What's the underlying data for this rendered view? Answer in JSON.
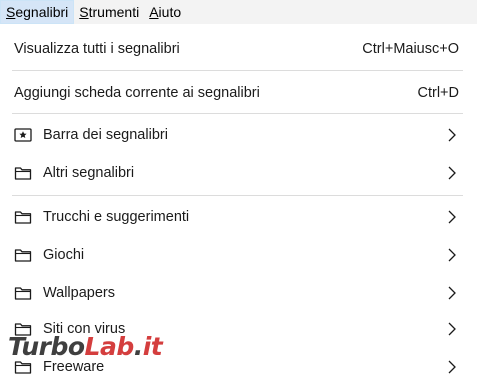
{
  "menubar": {
    "items": [
      {
        "acc": "S",
        "rest": "egnalibri",
        "active": true
      },
      {
        "acc": "S",
        "rest": "trumenti",
        "active": false
      },
      {
        "acc": "A",
        "rest": "iuto",
        "active": false
      }
    ]
  },
  "menu": {
    "show_all": {
      "label": "Visualizza tutti i segnalibri",
      "shortcut": "Ctrl+Maiusc+O"
    },
    "add_tabs": {
      "label": "Aggiungi scheda corrente ai segnalibri",
      "shortcut": "Ctrl+D"
    },
    "folders": [
      {
        "label": "Barra dei segnalibri",
        "icon": "bookmarks-toolbar-icon"
      },
      {
        "label": "Altri segnalibri",
        "icon": "folder-icon"
      },
      {
        "label": "Trucchi e suggerimenti",
        "icon": "folder-icon"
      },
      {
        "label": "Giochi",
        "icon": "folder-icon"
      },
      {
        "label": "Wallpapers",
        "icon": "folder-icon"
      },
      {
        "label": "Siti con virus",
        "icon": "folder-icon"
      },
      {
        "label": "Freeware",
        "icon": "folder-icon"
      }
    ]
  },
  "watermark": {
    "part1": "Turbo",
    "part2": "Lab",
    "part3": ".",
    "part4": "it"
  },
  "colors": {
    "menubar_bg": "#f3f3f3",
    "active_bg": "#d5e5f7",
    "separator": "#dcdcdc",
    "watermark_red": "#d02a2a"
  }
}
